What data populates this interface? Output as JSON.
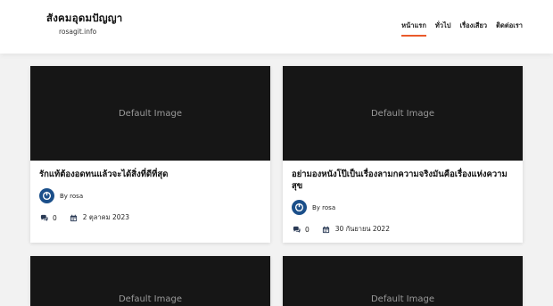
{
  "site": {
    "title": "สังคมอุดมปัญญา",
    "tagline": "rosagit.info"
  },
  "nav": {
    "items": [
      {
        "label": "หน้าแรก",
        "active": true
      },
      {
        "label": "ทั่วไป",
        "active": false
      },
      {
        "label": "เรื่องเสียว",
        "active": false
      },
      {
        "label": "ติดต่อเรา",
        "active": false
      }
    ],
    "accent_color": "#ea5a2b"
  },
  "posts": [
    {
      "image_text": "Default Image",
      "title": "รักแท้ต้องอดทนแล้วจะได้สิ่งที่ดีที่สุด",
      "author": "By rosa",
      "comments": "0",
      "date": "2 ตุลาคม 2023"
    },
    {
      "image_text": "Default Image",
      "title": "อย่ามองหนังโป๊เป็นเรื่องลามกความจริงมันคือเรื่องแห่งความสุข",
      "author": "By rosa",
      "comments": "0",
      "date": "30 กันยายน 2022"
    },
    {
      "image_text": "Default Image"
    },
    {
      "image_text": "Default Image"
    }
  ],
  "icons": {
    "comment": "comments-icon",
    "calendar": "calendar-icon",
    "avatar": "user-avatar-icon"
  }
}
